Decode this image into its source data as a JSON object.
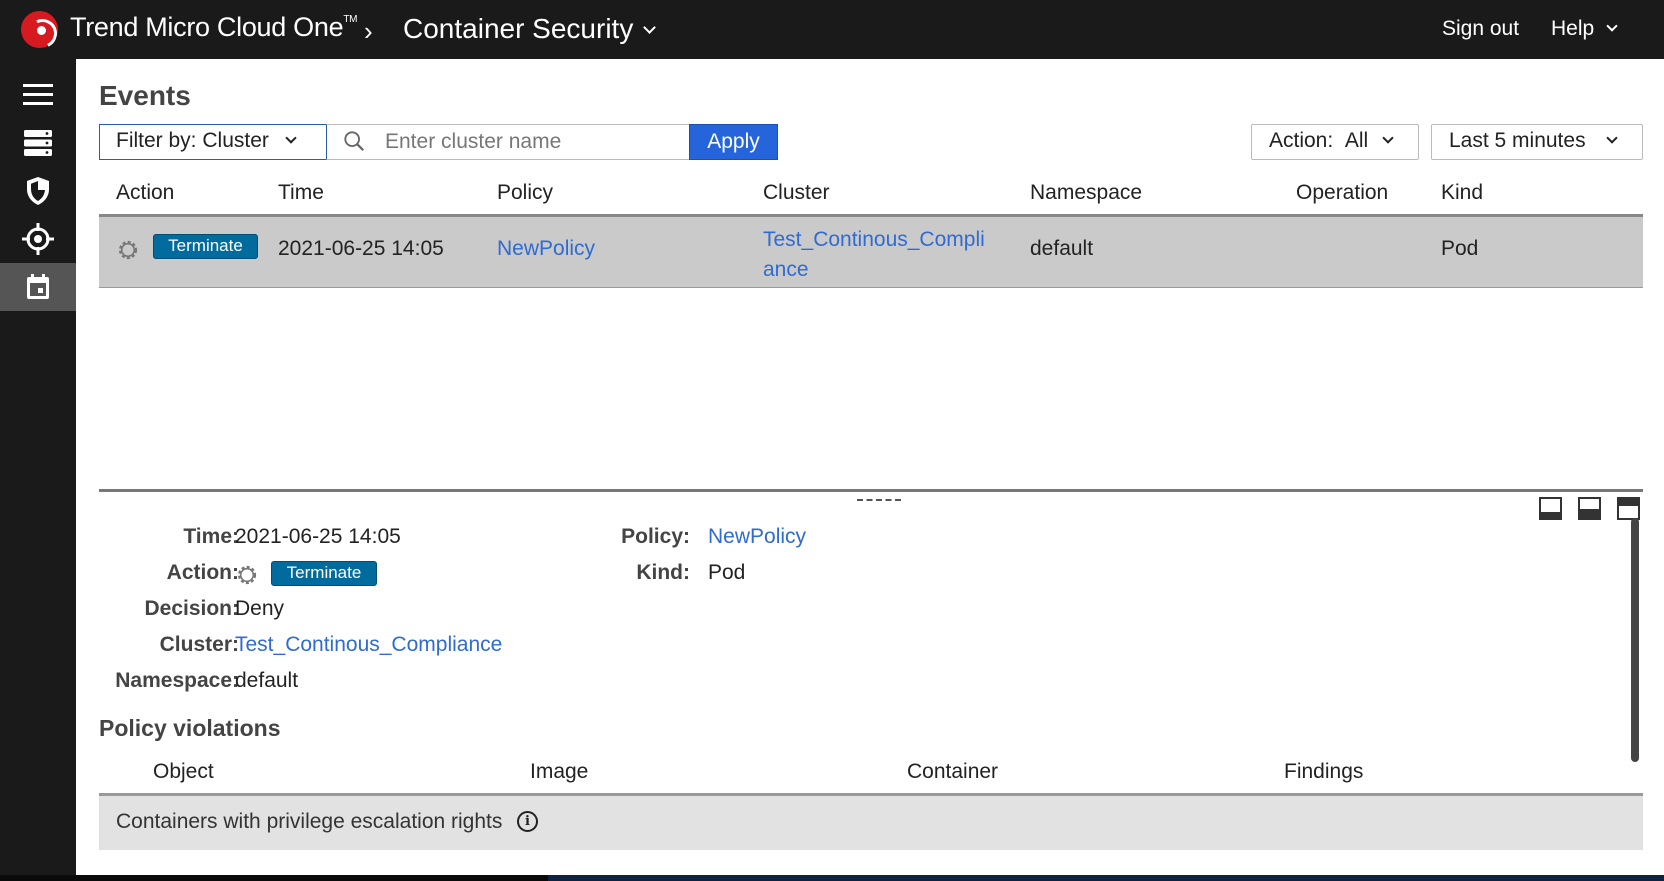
{
  "header": {
    "brand": "Trend Micro Cloud One",
    "brand_tm": "TM",
    "breadcrumb_separator": "›",
    "product": "Container Security",
    "sign_out": "Sign out",
    "help": "Help"
  },
  "sidebar": {
    "items": [
      {
        "icon": "menu-icon"
      },
      {
        "icon": "clusters-icon"
      },
      {
        "icon": "shield-icon"
      },
      {
        "icon": "crosshair-icon"
      },
      {
        "icon": "calendar-icon",
        "active": true
      }
    ]
  },
  "page": {
    "title": "Events"
  },
  "filter": {
    "label": "Filter by:",
    "value": "Cluster",
    "search_placeholder": "Enter cluster name",
    "search_value": "",
    "apply_label": "Apply",
    "action_label": "Action:",
    "action_value": "All",
    "time_range": "Last 5 minutes"
  },
  "table": {
    "columns": [
      "Action",
      "Time",
      "Policy",
      "Cluster",
      "Namespace",
      "Operation",
      "Kind"
    ],
    "rows": [
      {
        "action": "Terminate",
        "time": "2021-06-25 14:05",
        "policy": "NewPolicy",
        "cluster": "Test_Continous_Compliance",
        "namespace": "default",
        "operation": "",
        "kind": "Pod"
      }
    ]
  },
  "details": {
    "time_label": "Time:",
    "time": "2021-06-25 14:05",
    "action_label": "Action:",
    "action": "Terminate",
    "decision_label": "Decision:",
    "decision": "Deny",
    "cluster_label": "Cluster:",
    "cluster": "Test_Continous_Compliance",
    "namespace_label": "Namespace:",
    "namespace": "default",
    "policy_label": "Policy:",
    "policy": "NewPolicy",
    "kind_label": "Kind:",
    "kind": "Pod"
  },
  "violations": {
    "title": "Policy violations",
    "columns": [
      "Object",
      "Image",
      "Container",
      "Findings"
    ],
    "rows": [
      {
        "text": "Containers with privilege escalation rights",
        "info_icon": "i"
      }
    ]
  },
  "colors": {
    "topbar": "#1a1a1a",
    "accent_blue": "#2564db",
    "link": "#2f6bd1",
    "badge": "#006b9c",
    "row_selected": "#cacaca"
  }
}
